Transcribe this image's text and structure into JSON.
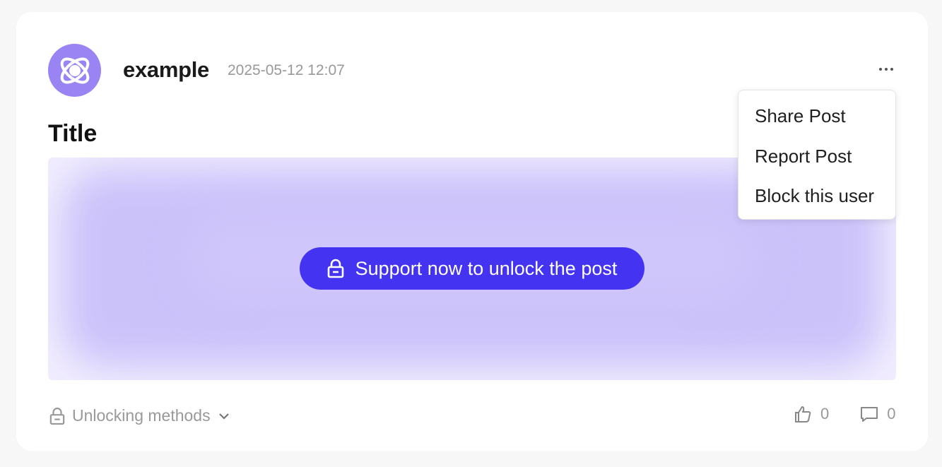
{
  "post": {
    "author": "example",
    "timestamp": "2025-05-12 12:07",
    "title": "Title",
    "unlock_button_label": "Support now to unlock the post",
    "unlocking_methods_label": "Unlocking methods",
    "likes": "0",
    "comments": "0"
  },
  "menu": {
    "items": [
      {
        "label": "Share Post"
      },
      {
        "label": "Report Post"
      },
      {
        "label": "Block this user"
      }
    ]
  },
  "colors": {
    "accent": "#4434f2",
    "avatar": "#9a83f3",
    "locked_overlay": "#c9c0fa",
    "muted_text": "#999999"
  },
  "icons": {
    "avatar": "atom-icon",
    "more": "more-dots-icon",
    "lock": "lock-icon",
    "chevron": "chevron-down-icon",
    "like": "thumbs-up-icon",
    "comment": "comment-icon"
  }
}
